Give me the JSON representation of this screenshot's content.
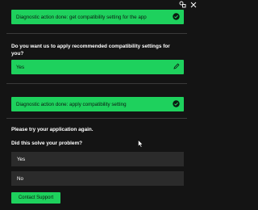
{
  "app": {
    "accent_color": "#1ed15d",
    "background_color": "#141414"
  },
  "top_icons": [
    "agent-icon",
    "close-icon"
  ],
  "steps": {
    "diagnostic_1": "Diagnostic action done: get compatibility setting for the app",
    "question_1": "Do you want us to apply recommended compatibility settings for you?",
    "answer_1": "Yes",
    "diagnostic_2": "Diagnostic action done: apply compatibility setting",
    "instruction": "Please try your application again.",
    "question_2": "Did this solve your problem?",
    "option_yes": "Yes",
    "option_no": "No",
    "contact_support": "Contact Support"
  }
}
